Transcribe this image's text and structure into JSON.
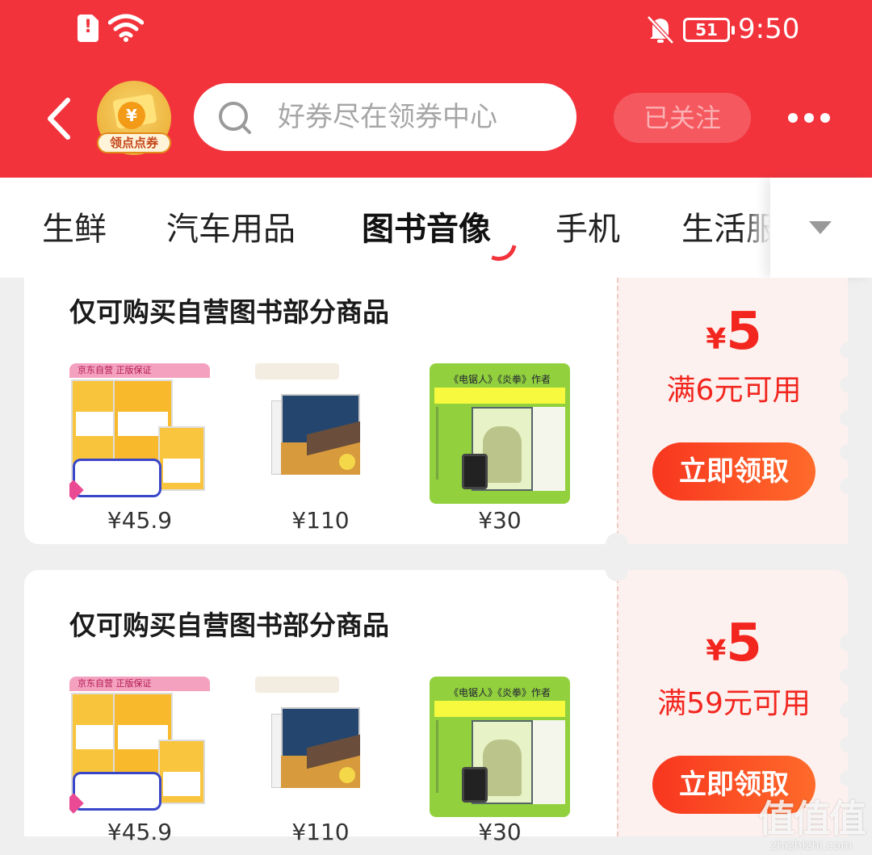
{
  "status_bar": {
    "time": "9:50",
    "battery": "51",
    "icons": [
      "sim-alert-icon",
      "wifi-icon",
      "bell-off-icon",
      "battery-icon"
    ]
  },
  "header": {
    "badge_label": "领点点券",
    "badge_symbol": "¥",
    "search_placeholder": "好券尽在领券中心",
    "follow_label": "已关注",
    "colors": {
      "brand": "#f2333c",
      "accent": "#ff4a24"
    }
  },
  "tabs": {
    "items": [
      {
        "label": "生鲜"
      },
      {
        "label": "汽车用品"
      },
      {
        "label": "图书音像"
      },
      {
        "label": "手机"
      },
      {
        "label": "生活服"
      }
    ],
    "active": "图书音像"
  },
  "coupons": [
    {
      "title": "仅可购买自营图书部分商品",
      "currency": "¥",
      "amount": "5",
      "threshold": "满6元可用",
      "button": "立即领取",
      "products": [
        {
          "price": "¥45.9",
          "band": "京东自营 正版保证"
        },
        {
          "price": "¥110"
        },
        {
          "price": "¥30",
          "banner": "《电锯人》《炎拳》作者"
        }
      ]
    },
    {
      "title": "仅可购买自营图书部分商品",
      "currency": "¥",
      "amount": "5",
      "threshold": "满59元可用",
      "button": "立即领取",
      "products": [
        {
          "price": "¥45.9",
          "band": "京东自营 正版保证"
        },
        {
          "price": "¥110"
        },
        {
          "price": "¥30",
          "banner": "《电锯人》《炎拳》作者"
        }
      ]
    }
  ],
  "watermark": {
    "big": "值值值",
    "small": "zhizhizhi.com"
  }
}
